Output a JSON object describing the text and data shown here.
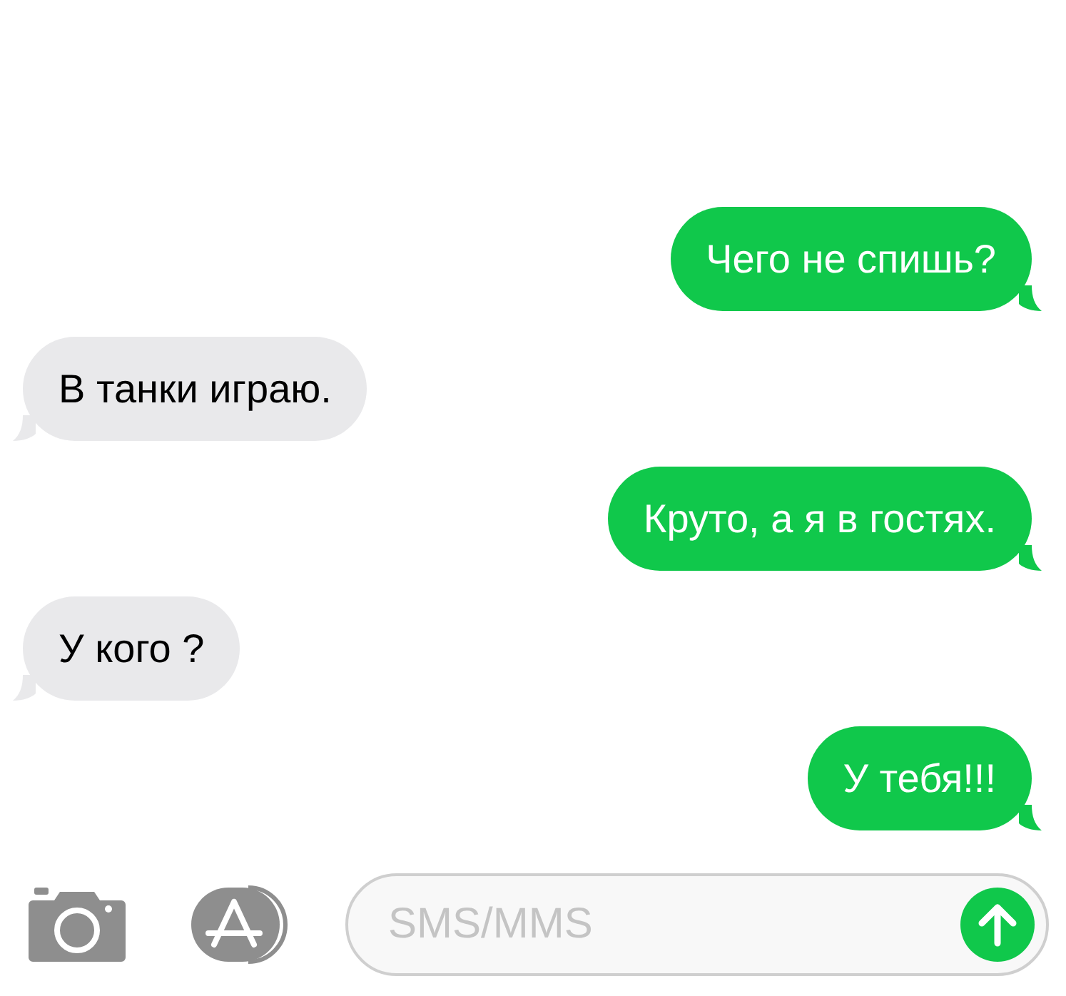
{
  "messages": [
    {
      "kind": "sent",
      "text": "Чего не спишь?"
    },
    {
      "kind": "received",
      "text": "В танки играю."
    },
    {
      "kind": "sent",
      "text": "Круто, а я в гостях."
    },
    {
      "kind": "received",
      "text": "У кого ?"
    },
    {
      "kind": "sent",
      "text": "У тебя!!!"
    }
  ],
  "composer": {
    "placeholder": "SMS/MMS"
  }
}
